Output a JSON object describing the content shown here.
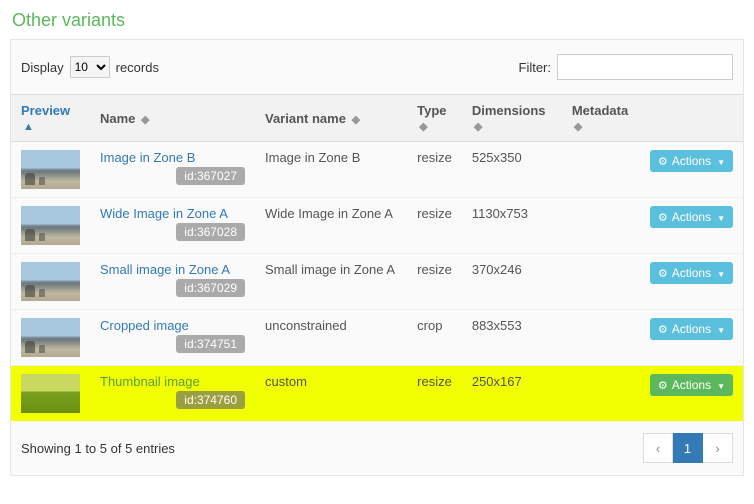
{
  "title": "Other variants",
  "controls": {
    "display_label": "Display",
    "records_label": "records",
    "per_page": "10",
    "filter_label": "Filter:",
    "filter_value": ""
  },
  "columns": {
    "preview": "Preview",
    "name": "Name",
    "variant": "Variant name",
    "type": "Type",
    "dimensions": "Dimensions",
    "metadata": "Metadata"
  },
  "rows": [
    {
      "thumb": "city",
      "name": "Image in Zone B",
      "id": "id:367027",
      "variant": "Image in Zone B",
      "type": "resize",
      "dimensions": "525x350",
      "metadata": "",
      "highlight": false,
      "actionStyle": "blue"
    },
    {
      "thumb": "city",
      "name": "Wide Image in Zone A",
      "id": "id:367028",
      "variant": "Wide Image in Zone A",
      "type": "resize",
      "dimensions": "1130x753",
      "metadata": "",
      "highlight": false,
      "actionStyle": "blue"
    },
    {
      "thumb": "city",
      "name": "Small image in Zone A",
      "id": "id:367029",
      "variant": "Small image in Zone A",
      "type": "resize",
      "dimensions": "370x246",
      "metadata": "",
      "highlight": false,
      "actionStyle": "blue"
    },
    {
      "thumb": "city",
      "name": "Cropped image",
      "id": "id:374751",
      "variant": "unconstrained",
      "type": "crop",
      "dimensions": "883x553",
      "metadata": "",
      "highlight": false,
      "actionStyle": "blue"
    },
    {
      "thumb": "green",
      "name": "Thumbnail image",
      "id": "id:374760",
      "variant": "custom",
      "type": "resize",
      "dimensions": "250x167",
      "metadata": "",
      "highlight": true,
      "actionStyle": "green"
    }
  ],
  "actions_label": "Actions",
  "footer": {
    "info": "Showing 1 to 5 of 5 entries",
    "prev": "‹",
    "next": "›",
    "current_page": "1"
  }
}
